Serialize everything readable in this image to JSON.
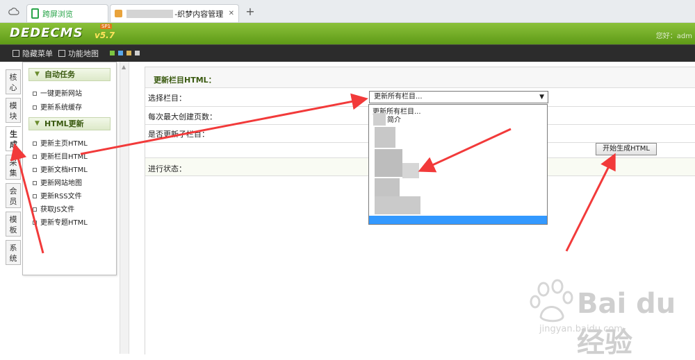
{
  "browser": {
    "tabs": [
      {
        "label": "跨屏浏览"
      },
      {
        "label": "-织梦内容管理"
      }
    ],
    "new_tab": "+",
    "close": "✕"
  },
  "header": {
    "logo": "DEDECMS",
    "version": "v5.7",
    "badge": "SP1",
    "greeting": "您好：adm"
  },
  "toolbar": {
    "hide_menu": "隐藏菜单",
    "site_map": "功能地图",
    "squares": [
      "#7cc542",
      "#5aa7e8",
      "#d9b45a",
      "#cfcfcf"
    ]
  },
  "side_tabs": [
    "核心",
    "模块",
    "生成",
    "采集",
    "会员",
    "模板",
    "系统"
  ],
  "menu": {
    "group1": {
      "title": "自动任务",
      "items": [
        "一键更新网站",
        "更新系统缓存"
      ]
    },
    "group2": {
      "title": "HTML更新",
      "items": [
        "更新主页HTML",
        "更新栏目HTML",
        "更新文档HTML",
        "更新网站地图",
        "更新RSS文件",
        "获取JS文件",
        "更新专题HTML"
      ]
    }
  },
  "main": {
    "section_title": "更新栏目HTML：",
    "fields": {
      "select_label": "选择栏目：",
      "select_value": "更新所有栏目...",
      "max_pages_label": "每次最大创建页数：",
      "subcol_label": "是否更新子栏目：",
      "status_label": "进行状态："
    },
    "dropdown": {
      "options": [
        "更新所有栏目...",
        "简介"
      ]
    },
    "start_button": "开始生成HTML"
  },
  "watermark": {
    "brand": "Bai du 经验",
    "url": "jingyan.baidu.com"
  },
  "colors": {
    "header_green": "#6ea523",
    "arrow_red": "#f23a3a",
    "selection_blue": "#3399ff"
  }
}
